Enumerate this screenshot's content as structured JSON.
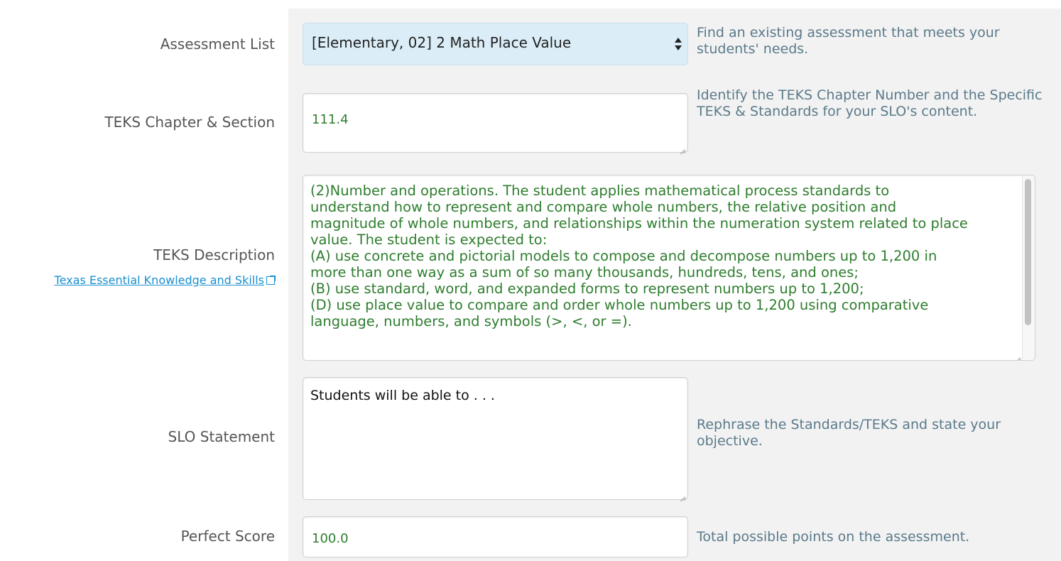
{
  "assessment_list": {
    "label": "Assessment List",
    "selected": "[Elementary, 02] 2 Math Place Value",
    "help": "Find an existing assessment that meets your students' needs."
  },
  "teks_chapter": {
    "label": "TEKS Chapter & Section",
    "value": "111.4",
    "help": "Identify the TEKS Chapter Number and the Specific TEKS & Standards for your SLO's content."
  },
  "teks_description": {
    "label": "TEKS Description",
    "link_text": "Texas Essential Knowledge and Skills",
    "lines": [
      "(2)Number and operations. The student applies mathematical process standards to",
      "understand how to represent and compare whole numbers, the relative position and",
      "magnitude of whole numbers, and relationships within the numeration system related to place",
      "value. The student is expected to:",
      "(A)  use concrete and pictorial models to compose and decompose numbers up to 1,200 in",
      "more than one way as a sum of so many thousands, hundreds, tens, and ones;",
      "(B)  use standard, word, and expanded forms to represent numbers up to 1,200;",
      "(D)  use place value to compare and order whole numbers up to 1,200 using comparative",
      "language, numbers, and symbols (>, <, or =)."
    ]
  },
  "slo_statement": {
    "label": "SLO Statement",
    "value": "Students will be able to . . .",
    "help": "Rephrase the Standards/TEKS and state your objective."
  },
  "perfect_score": {
    "label": "Perfect Score",
    "value": "100.0",
    "help": "Total possible points on the assessment."
  },
  "colors": {
    "panel_bg": "#f2f2f2",
    "select_bg": "#dbeef8",
    "entered_text": "#2e7d2e",
    "help_text": "#5a7a8a",
    "link": "#1a8fd0"
  }
}
